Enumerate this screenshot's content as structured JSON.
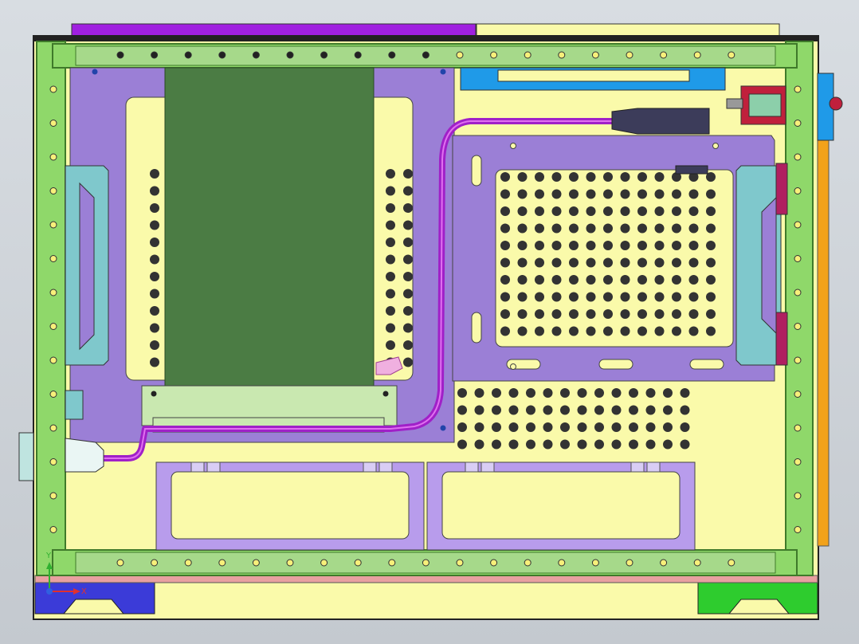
{
  "viewport": {
    "name": "cad-graphics-area",
    "background_top": "#d8dde2",
    "background_bottom": "#c4c9cf"
  },
  "colors": {
    "rail_green": "#8fd86a",
    "rail_dark": "#3f7a2a",
    "rail_inner": "#a6d98a",
    "hole_yellow": "#f7f07a",
    "base_yellow": "#fafaaa",
    "plate_purple": "#9b7fd6",
    "plate_light": "#b89cec",
    "pcb_green": "#4b7c44",
    "pcb_header": "#c9e8b0",
    "bracket_cyan": "#7fc8cc",
    "cable_magenta": "#a020c8",
    "connector_dark": "#3c3c5a",
    "top_blue": "#1f9ae8",
    "right_orange": "#f2a21a",
    "bottom_blue": "#3b3bd8",
    "bottom_green": "#2ecc2e",
    "top_purple": "#a020e0",
    "red_connector": "#c0203c"
  },
  "triad": {
    "x_label": "X",
    "y_label": "Y",
    "x_color": "#e03030",
    "y_color": "#30b030",
    "z_color": "#3060e0"
  }
}
